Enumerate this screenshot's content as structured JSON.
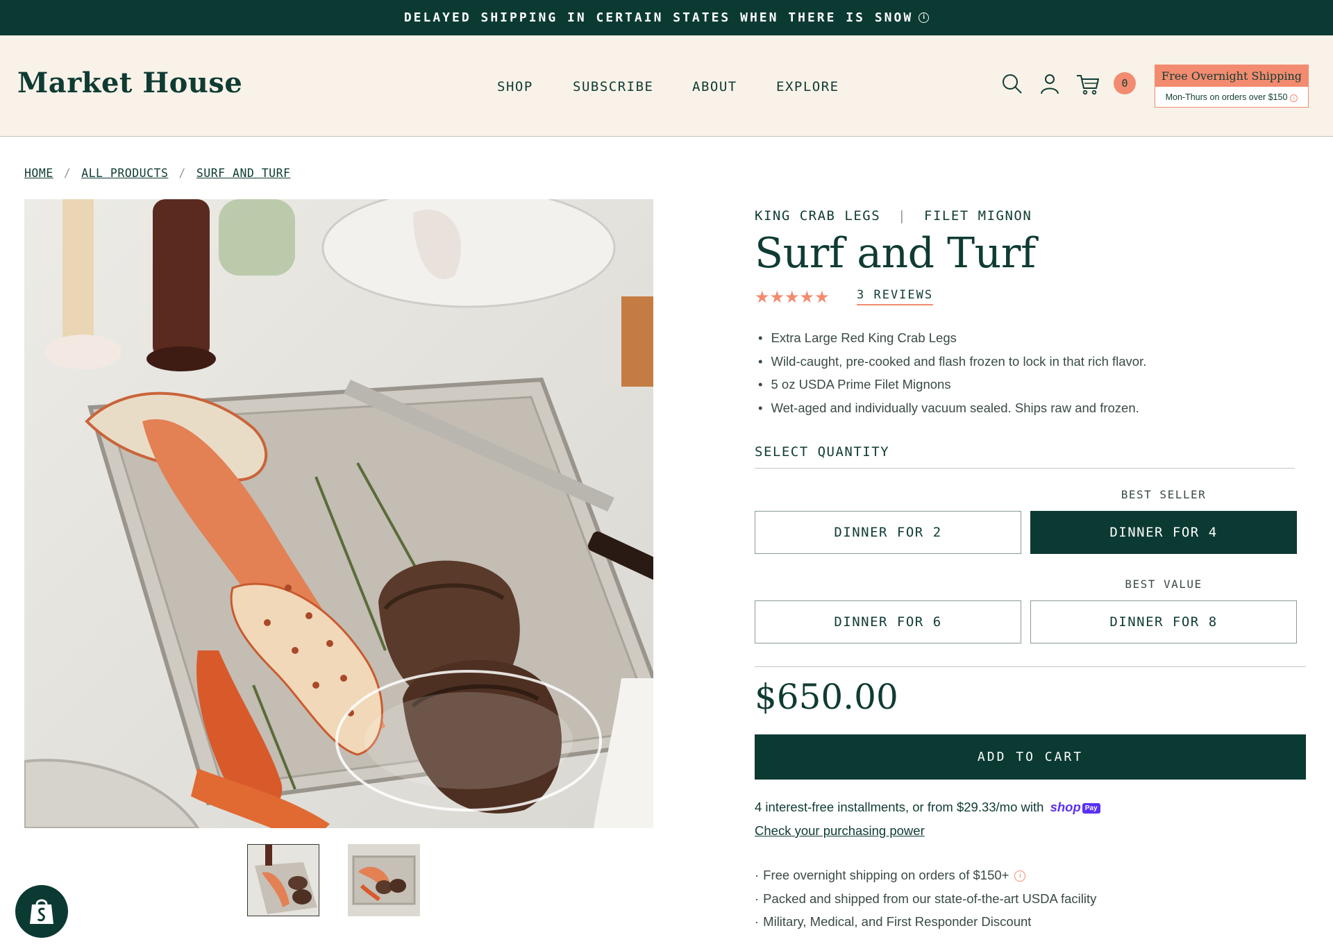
{
  "announcement": {
    "text": "DELAYED SHIPPING IN CERTAIN STATES WHEN THERE IS SNOW",
    "info_glyph": "i"
  },
  "header": {
    "logo": "Market House",
    "nav": [
      "SHOP",
      "SUBSCRIBE",
      "ABOUT",
      "EXPLORE"
    ],
    "cart_count": "0",
    "shipping_promo": {
      "title": "Free Overnight Shipping",
      "subtitle": "Mon-Thurs on orders over $150"
    },
    "icons": [
      "search-icon",
      "account-icon",
      "cart-icon"
    ]
  },
  "breadcrumb": [
    "HOME",
    "ALL PRODUCTS",
    "SURF AND TURF"
  ],
  "product": {
    "kicker_left": "KING CRAB LEGS",
    "kicker_sep": "|",
    "kicker_right": "FILET MIGNON",
    "title": "Surf and Turf",
    "rating": 5,
    "stars_text": "★★★★★",
    "reviews_label": "3 REVIEWS",
    "bullets": [
      "Extra Large Red King Crab Legs",
      "Wild-caught, pre-cooked and flash frozen to lock in that rich flavor.",
      "5 oz USDA Prime Filet Mignons",
      "Wet-aged and individually vacuum sealed. Ships raw and frozen."
    ],
    "select_label": "SELECT QUANTITY",
    "badges": [
      "BEST SELLER",
      "BEST VALUE"
    ],
    "options": [
      {
        "label": "DINNER FOR 2",
        "selected": false
      },
      {
        "label": "DINNER FOR 4",
        "selected": true
      },
      {
        "label": "DINNER FOR 6",
        "selected": false
      },
      {
        "label": "DINNER FOR 8",
        "selected": false
      }
    ],
    "price": "$650.00",
    "add_to_cart": "ADD TO CART",
    "installments": "4 interest-free installments, or from $29.33/mo with",
    "shop_pay_word": "shop",
    "shop_pay_badge": "Pay",
    "purchasing_link": "Check your purchasing power",
    "perks": [
      "Free overnight shipping on orders of $150+",
      "Packed and shipped from our state-of-the-art USDA facility",
      "Military, Medical, and First Responder Discount"
    ]
  },
  "colors": {
    "primary": "#0b3a33",
    "accent": "#f28b6f",
    "header_bg": "#f8f2e8"
  }
}
